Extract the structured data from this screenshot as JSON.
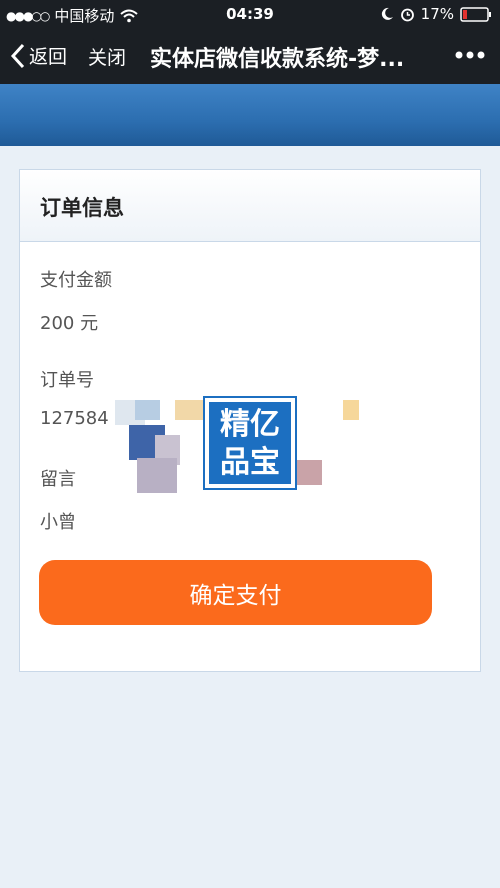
{
  "status_bar": {
    "carrier": "中国移动",
    "time": "04:39",
    "battery": "17%"
  },
  "nav": {
    "back_label": "返回",
    "close_label": "关闭",
    "title": "实体店微信收款系统-梦..."
  },
  "card": {
    "title": "订单信息",
    "amount_label": "支付金额",
    "amount_value": "200 元",
    "order_label": "订单号",
    "order_value": "127584",
    "message_label": "留言",
    "message_value": "小曾",
    "pay_button": "确定支付"
  },
  "watermark": {
    "line1": "精亿",
    "line2": "品宝"
  },
  "colors": {
    "accent": "#fb6a1c",
    "header_blue": "#2c6eb0",
    "bar": "#1b1f24"
  }
}
